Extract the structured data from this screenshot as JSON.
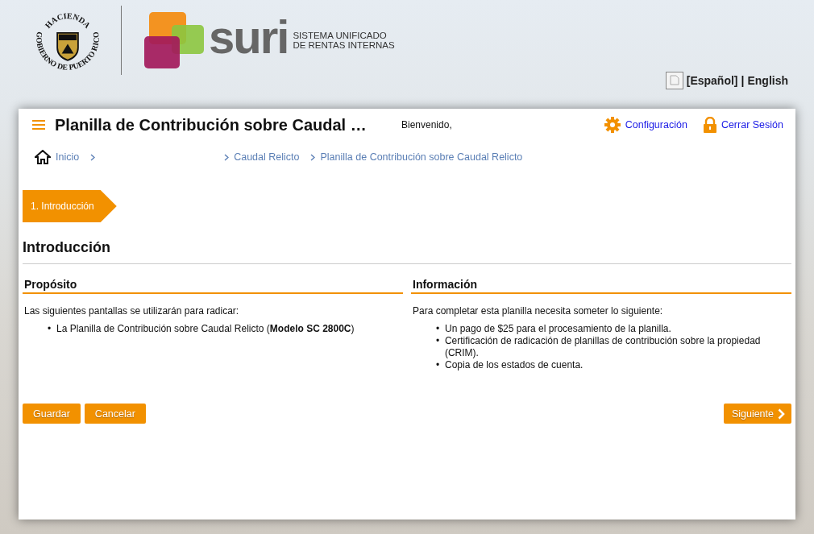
{
  "logo": {
    "seal_top": "HACIENDA",
    "seal_ring": "GOBIERNO DE PUERTO RICO",
    "brand": "suri",
    "tagline": [
      "SISTEMA UNIFICADO",
      "DE RENTAS INTERNAS"
    ]
  },
  "languages": [
    "[Español]",
    "English"
  ],
  "language_separator": "|",
  "header": {
    "title": "Planilla de Contribución sobre Caudal …",
    "welcome": "Bienvenido,",
    "links": [
      {
        "kind": "settings",
        "label": "Configuración"
      },
      {
        "kind": "logout",
        "label": "Cerrar Sesión"
      }
    ]
  },
  "breadcrumbs": {
    "home": "Inicio",
    "trail": [
      "Caudal Relicto",
      "Planilla de Contribución sobre Caudal Relicto"
    ]
  },
  "steps": [
    {
      "label": "1. Introducción",
      "selected": true
    }
  ],
  "heading": "Introducción",
  "bullet": "•",
  "sections": [
    {
      "title": "Propósito",
      "intro": "Las siguientes pantallas se utilizarán para radicar:",
      "items": [
        "La Planilla de Contribución sobre Caudal Relicto (**Modelo SC 2800C**)"
      ]
    },
    {
      "title": "Información",
      "intro": "Para completar esta planilla necesita someter lo siguiente:",
      "items": [
        "Un pago de $25 para el procesamiento de la planilla.",
        "Certificación de radicación de planillas de contribución sobre la propiedad (CRIM).",
        "Copia de los estados de cuenta."
      ]
    }
  ],
  "buttons": {
    "left": [
      "Guardar",
      "Cancelar"
    ],
    "next": "Siguiente"
  }
}
